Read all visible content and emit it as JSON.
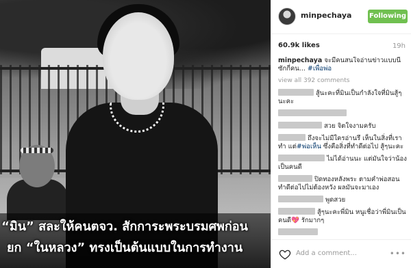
{
  "photo": {
    "caption_line1": "“มิน” สละให้คนตจว. สักการะพระบรมศพก่อน",
    "caption_line2": "ยก “ในหลวง” ทรงเป็นต้นแบบในการทำงาน"
  },
  "post": {
    "username": "minpechaya",
    "follow_label": "Following",
    "likes": "60.9k likes",
    "time_ago": "19h",
    "caption_text": "จะมีคนสนใจอ่านข่าวแบบนี้ซักกี่คน...",
    "caption_hashtag": "#เพื่อพ่อ",
    "view_all": "view all 392 comments",
    "comments": [
      {
        "text": "สู้นะคะที่มินเป็นกำลังใจที่มินสู้ๆนะคะ"
      },
      {
        "text": ""
      },
      {
        "text": "สวย จิตใจงามครับ"
      },
      {
        "text": "ถึงจะไม่มีใครอ่านรึ เห็นในสิ่งที่เราทำ แต่",
        "hashtag": "#พ่อเห็น",
        "after": " ซึ่งคือสิ่งที่ทำดีต่อไป สู้ๆนะคะ"
      },
      {
        "text": "ไม่ได้อ่านนะ แต่มันใจว่าน้องเป็นคนดี"
      },
      {
        "text": "ปิดทองหลังพระ ตามคำพ่อสอน ทำดีต่อไปไม่ต้องหวัง ผลมันจะมาเอง"
      },
      {
        "text": "พูดสวย"
      },
      {
        "text": "สู้ๆนะคะพี่มิน หนูเชื่อว่าพี่มินเป็นคนดี💖 รักมากๆ"
      },
      {
        "text": ""
      }
    ],
    "add_comment_placeholder": "Add a comment...",
    "more_label": "•••"
  },
  "colors": {
    "follow_green": "#70c050",
    "hashtag_blue": "#003569",
    "muted_gray": "#999999",
    "redaction_gray": "#c9c9c9"
  },
  "icons": [
    "heart-icon",
    "more-options-icon"
  ]
}
